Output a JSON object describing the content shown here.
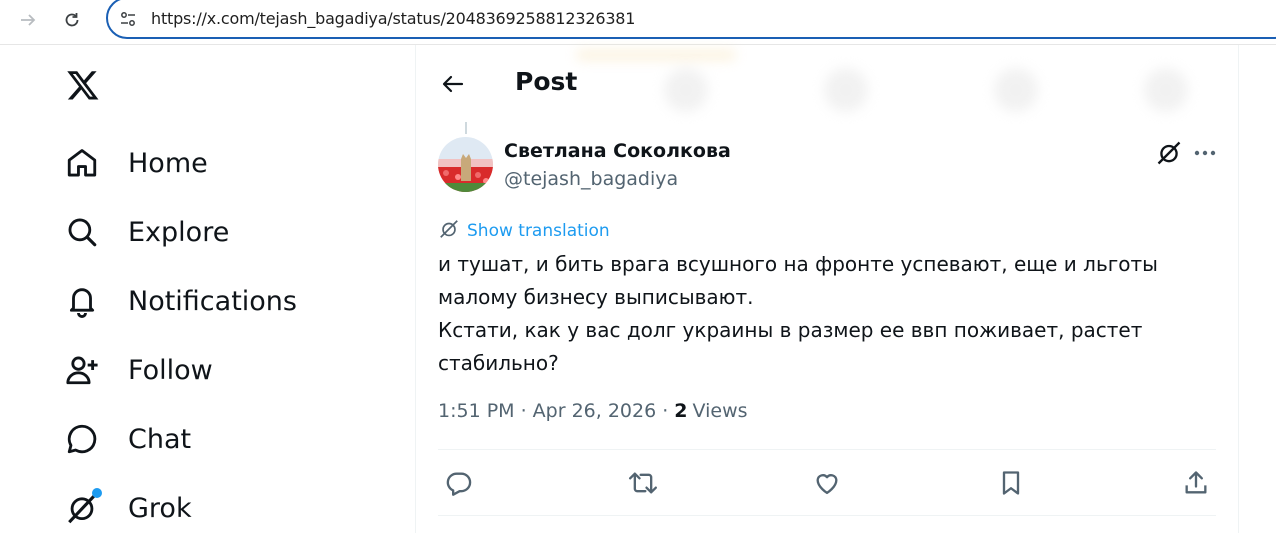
{
  "browser": {
    "url": "https://x.com/tejash_bagadiya/status/2048369258812326381"
  },
  "sidebar": {
    "logo": "x-logo-icon",
    "items": [
      {
        "label": "Home",
        "icon": "home-icon"
      },
      {
        "label": "Explore",
        "icon": "search-icon"
      },
      {
        "label": "Notifications",
        "icon": "bell-icon"
      },
      {
        "label": "Follow",
        "icon": "add-user-icon"
      },
      {
        "label": "Chat",
        "icon": "chat-icon"
      },
      {
        "label": "Grok",
        "icon": "grok-icon"
      }
    ]
  },
  "header": {
    "title": "Post"
  },
  "post": {
    "author_name": "Светлана Соколкова",
    "author_handle": "@tejash_bagadiya",
    "translate_label": "Show translation",
    "text_lines": [
      "и тушат, и бить врага всушного на фронте успевают, еще и льготы",
      "малому бизнесу выписывают.",
      "Кстати, как  у вас долг украины в размер ее ввп поживает, растет",
      "стабильно?"
    ],
    "timestamp": "1:51 PM · Apr 26, 2026 ·",
    "views_count": "2",
    "views_label": "Views"
  },
  "actions": [
    "reply-icon",
    "retweet-icon",
    "like-icon",
    "bookmark-icon",
    "share-icon"
  ],
  "colors": {
    "accent": "#1d9bf0",
    "text": "#0f1419",
    "secondary": "#536471",
    "urlbar_border": "#1a5fb4"
  }
}
